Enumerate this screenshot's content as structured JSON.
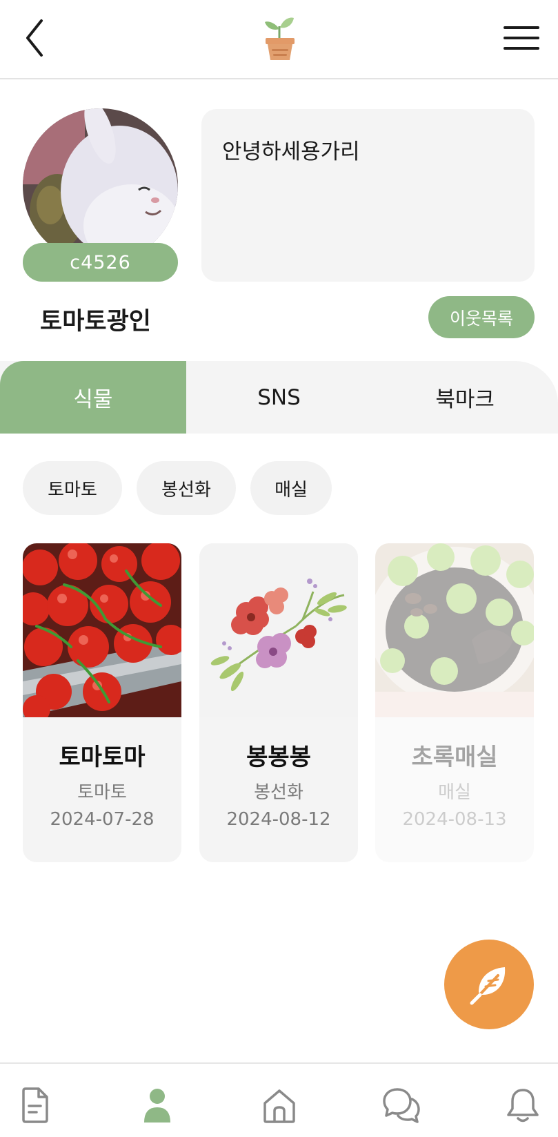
{
  "header": {
    "back_icon": "chevron-left-icon",
    "logo_icon": "sprout-pot-logo",
    "menu_icon": "hamburger-menu-icon"
  },
  "profile": {
    "avatar": "white-rabbit-avatar",
    "user_code": "c4526",
    "bio": "안녕하세용가리",
    "name": "토마토광인",
    "neighbors_label": "이웃목록"
  },
  "tabs": [
    {
      "label": "식물",
      "active": true
    },
    {
      "label": "SNS",
      "active": false
    },
    {
      "label": "북마크",
      "active": false
    }
  ],
  "filters": [
    {
      "label": "토마토"
    },
    {
      "label": "봉선화"
    },
    {
      "label": "매실"
    }
  ],
  "plants": [
    {
      "name": "토마토마",
      "species": "토마토",
      "date": "2024-07-28",
      "photo": "tomatoes-photo",
      "faded": false
    },
    {
      "name": "봉봉봉",
      "species": "봉선화",
      "date": "2024-08-12",
      "photo": "flower-bouquet-photo",
      "faded": false
    },
    {
      "name": "초록매실",
      "species": "매실",
      "date": "2024-08-13",
      "photo": "green-plum-photo",
      "faded": true
    }
  ],
  "fab": {
    "icon": "feather-icon"
  },
  "bottom_nav": [
    {
      "icon": "document-icon",
      "active": false
    },
    {
      "icon": "profile-icon",
      "active": true
    },
    {
      "icon": "home-icon",
      "active": false
    },
    {
      "icon": "chat-bubbles-icon",
      "active": false
    },
    {
      "icon": "bell-icon",
      "active": false
    }
  ],
  "colors": {
    "accent_green": "#8fb886",
    "fab_orange": "#ee9a48",
    "surface_gray": "#f4f4f4",
    "nav_gray": "#8a8a8a"
  }
}
